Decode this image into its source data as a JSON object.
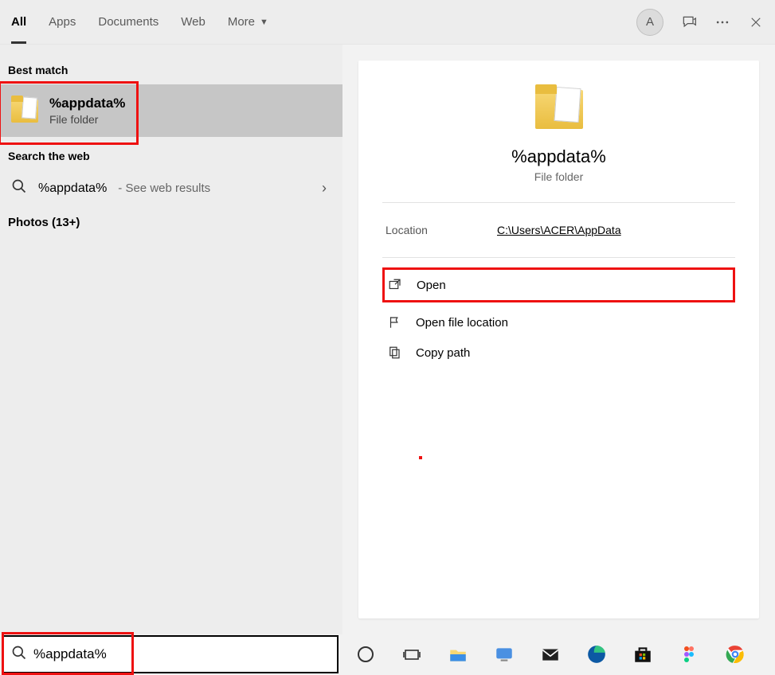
{
  "header": {
    "tabs": [
      "All",
      "Apps",
      "Documents",
      "Web",
      "More"
    ],
    "avatar_letter": "A"
  },
  "left": {
    "best_match_label": "Best match",
    "best": {
      "title": "%appdata%",
      "subtitle": "File folder"
    },
    "web_label": "Search the web",
    "web_query": "%appdata%",
    "web_hint": " - See web results",
    "photos_label": "Photos (13+)"
  },
  "preview": {
    "title": "%appdata%",
    "subtitle": "File folder",
    "location_label": "Location",
    "location_value": "C:\\Users\\ACER\\AppData",
    "actions": {
      "open": "Open",
      "open_loc": "Open file location",
      "copy_path": "Copy path"
    }
  },
  "search": {
    "value": "%appdata%"
  }
}
